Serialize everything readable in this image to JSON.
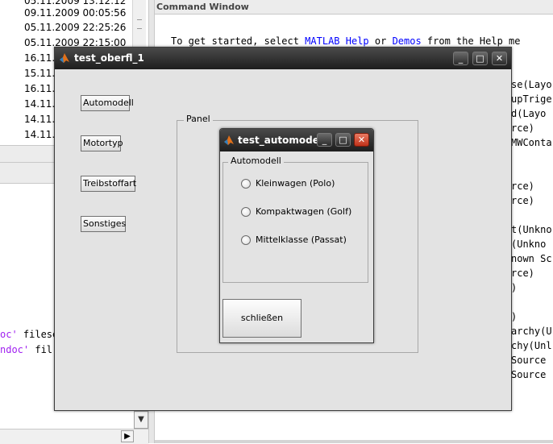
{
  "history": {
    "rows": [
      "09.11.2009 00:05:56",
      "05.11.2009 22:25:26",
      "05.11.2009 22:15:00",
      "16.11.",
      "15.11.",
      "16.11.",
      "14.11.",
      "14.11.",
      "14.11."
    ]
  },
  "editor": {
    "line1_str": "oc'",
    "line1_rest": " filese",
    "line2_str": "ndoc'",
    "line2_rest": " fil"
  },
  "command_window": {
    "title": "Command Window",
    "intro_a": "To get started, select ",
    "intro_link1": "MATLAB Help",
    "intro_b": " or ",
    "intro_link2": "Demos",
    "intro_c": " from the Help me",
    "lines": [
      "se(Layo",
      "upTrige",
      "d(Layo",
      "rce)",
      "MWConta",
      "",
      "",
      "rce)",
      "rce)",
      "",
      "t(Unkno",
      "(Unkno",
      "nown Sc",
      "rce)",
      ")",
      "",
      ")",
      "archy(U",
      "chy(Unl",
      "Source",
      "Source"
    ]
  },
  "fig1": {
    "title": "test_oberfl_1",
    "buttons": [
      "Automodell",
      "Motortyp",
      "Treibstoffart",
      "Sonstiges"
    ],
    "panel_label": "Panel"
  },
  "fig2": {
    "title": "test_automodell",
    "panel_label": "Automodell",
    "radios": [
      "Kleinwagen (Polo)",
      "Kompaktwagen (Golf)",
      "Mittelklasse (Passat)"
    ],
    "close_label": "schließen"
  },
  "window_controls": {
    "minimize": "_",
    "maximize": "□",
    "close": "✕"
  },
  "colors": {
    "titlebar": "#2a2a2a",
    "link": "#0000ff",
    "string": "#a020f0",
    "close_red": "#d9472b"
  }
}
